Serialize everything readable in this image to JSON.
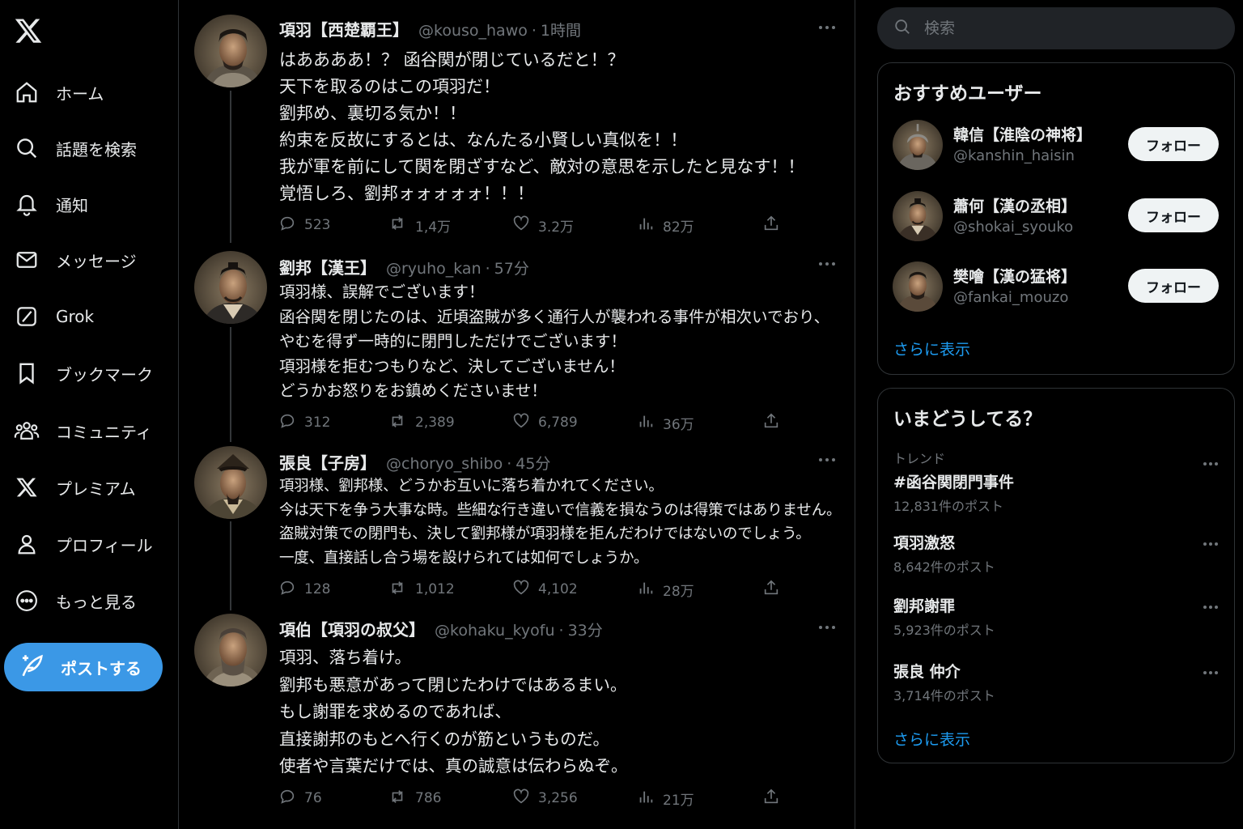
{
  "nav": {
    "logo": "x-logo-icon",
    "items": [
      {
        "label": "ホーム",
        "icon": "home-icon"
      },
      {
        "label": "話題を検索",
        "icon": "search-icon"
      },
      {
        "label": "通知",
        "icon": "bell-icon"
      },
      {
        "label": "メッセージ",
        "icon": "mail-icon"
      },
      {
        "label": "Grok",
        "icon": "grok-icon"
      },
      {
        "label": "ブックマーク",
        "icon": "bookmark-icon"
      },
      {
        "label": "コミュニティ",
        "icon": "community-icon"
      },
      {
        "label": "プレミアム",
        "icon": "x-premium-icon"
      },
      {
        "label": "プロフィール",
        "icon": "person-icon"
      },
      {
        "label": "もっと見る",
        "icon": "more-circle-icon"
      }
    ],
    "post_button": "ポストする",
    "accent_color": "#3b98e6"
  },
  "timeline": {
    "tweets": [
      {
        "name": "項羽【西楚覇王】",
        "handle": "@kouso_hawo",
        "time": "1時間",
        "lines": [
          "はああああ！？ 函谷関が閉じているだと！？",
          "天下を取るのはこの項羽だ！",
          "劉邦め、裏切る気か！！",
          "約束を反故にするとは、なんたる小賢しい真似を！！",
          "我が軍を前にして関を閉ざすなど、敵対の意思を示したと見なす！！",
          "覚悟しろ、劉邦ォォォォォ！！！"
        ],
        "stats": {
          "replies": "523",
          "retweets": "1,4万",
          "likes": "3.2万",
          "views": "82万"
        }
      },
      {
        "name": "劉邦【漢王】",
        "handle": "@ryuho_kan",
        "time": "57分",
        "lines": [
          "項羽様、誤解でございます！",
          "函谷関を閉じたのは、近頃盗賊が多く通行人が襲われる事件が相次いでおり、",
          "やむを得ず一時的に閉門しただけでございます！",
          "項羽様を拒むつもりなど、決してございません！",
          "どうかお怒りをお鎮めくださいませ！"
        ],
        "stats": {
          "replies": "312",
          "retweets": "2,389",
          "likes": "6,789",
          "views": "36万"
        }
      },
      {
        "name": "張良【子房】",
        "handle": "@choryo_shibo",
        "time": "45分",
        "lines": [
          "項羽様、劉邦様、どうかお互いに落ち着かれてください。",
          "今は天下を争う大事な時。些細な行き違いで信義を損なうのは得策ではありません。",
          "盗賊対策での閉門も、決して劉邦様が項羽様を拒んだわけではないのでしょう。",
          "一度、直接話し合う場を設けられては如何でしょうか。"
        ],
        "stats": {
          "replies": "128",
          "retweets": "1,012",
          "likes": "4,102",
          "views": "28万"
        }
      },
      {
        "name": "項伯【項羽の叔父】",
        "handle": "@kohaku_kyofu",
        "time": "33分",
        "lines": [
          "項羽、落ち着け。",
          "劉邦も悪意があって閉じたわけではあるまい。",
          "もし謝罪を求めるのであれば、",
          "直接謝邦のもとへ行くのが筋というものだ。",
          "使者や言葉だけでは、真の誠意は伝わらぬぞ。"
        ],
        "stats": {
          "replies": "76",
          "retweets": "786",
          "likes": "3,256",
          "views": "21万"
        }
      }
    ]
  },
  "search": {
    "placeholder": "検索"
  },
  "who_to_follow": {
    "title": "おすすめユーザー",
    "users": [
      {
        "name": "韓信【淮陰の神将】",
        "handle": "@kanshin_haisin",
        "button": "フォロー"
      },
      {
        "name": "蕭何【漢の丞相】",
        "handle": "@shokai_syouko",
        "button": "フォロー"
      },
      {
        "name": "樊噲【漢の猛将】",
        "handle": "@fankai_mouzo",
        "button": "フォロー"
      }
    ],
    "show_more": "さらに表示"
  },
  "trends": {
    "title": "いまどうしてる？",
    "items": [
      {
        "meta": "トレンド",
        "title": "#函谷関閉門事件",
        "count": "12,831件のポスト"
      },
      {
        "meta": "",
        "title": "項羽激怒",
        "count": "8,642件のポスト"
      },
      {
        "meta": "",
        "title": "劉邦謝罪",
        "count": "5,923件のポスト"
      },
      {
        "meta": "",
        "title": "張良 仲介",
        "count": "3,714件のポスト"
      }
    ],
    "show_more": "さらに表示"
  }
}
